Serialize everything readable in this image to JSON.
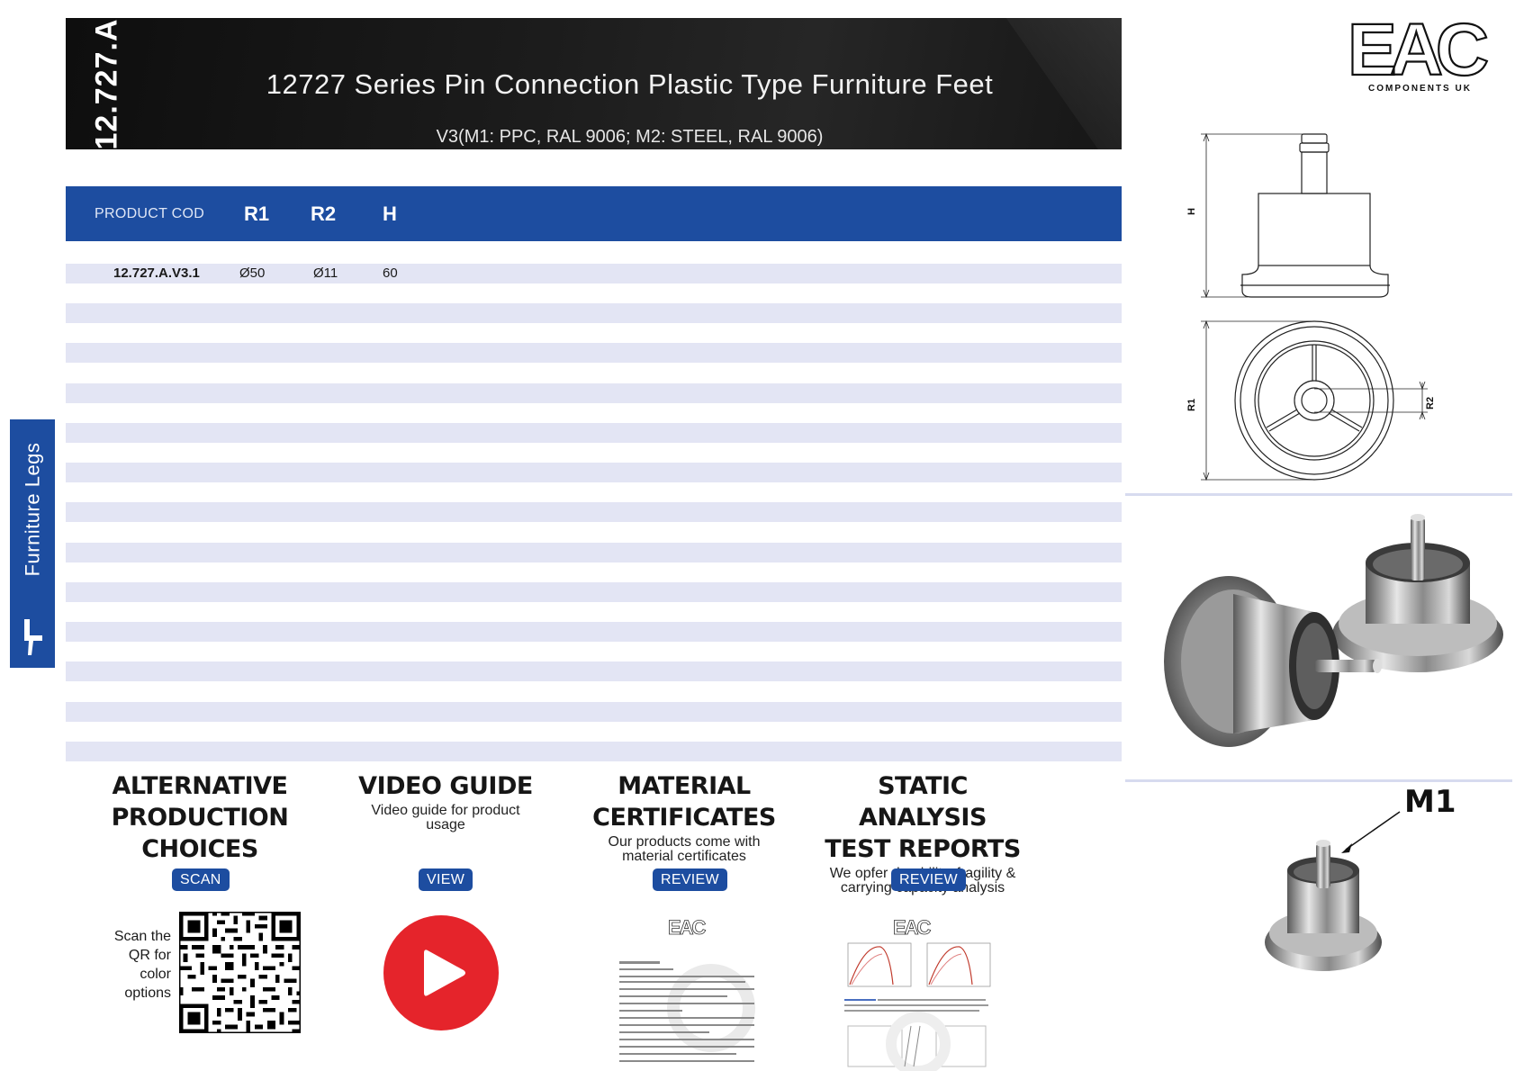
{
  "header": {
    "series_code": "12.727.A",
    "title": "12727 Series Pin Connection Plastic Type Furniture Feet",
    "subtitle": "V3(M1: PPC, RAL 9006; M2: STEEL, RAL 9006)"
  },
  "table": {
    "columns": [
      "PRODUCT COD",
      "R1",
      "R2",
      "H"
    ],
    "rows": [
      {
        "code": "12.727.A.V3.1",
        "r1": "Ø50",
        "r2": "Ø11",
        "h": "60"
      }
    ]
  },
  "sidebar": {
    "category": "Furniture Legs"
  },
  "logo": {
    "letters": "EAC",
    "tagline": "COMPONENTS UK"
  },
  "drawing": {
    "label_h": "H",
    "label_r1": "R1",
    "label_r2": "R2"
  },
  "callout": {
    "label": "M1"
  },
  "info_blocks": [
    {
      "title_lines": [
        "ALTERNATIVE",
        "PRODUCTION",
        "CHOICES"
      ],
      "description": "",
      "button": "SCAN"
    },
    {
      "title_lines": [
        "VIDEO GUIDE"
      ],
      "description": "Video guide for product usage",
      "button": "VIEW"
    },
    {
      "title_lines": [
        "MATERIAL",
        "CERTIFICATES"
      ],
      "description": "Our products come with material certificates",
      "button": "REVIEW"
    },
    {
      "title_lines": [
        "STATIC ANALYSIS",
        "TEST REPORTS"
      ],
      "description": "We opfer durability, fragility & carrying capacity analysis",
      "button": "REVIEW"
    }
  ],
  "scan_note": "Scan the QR for color options",
  "colors": {
    "brand_blue": "#1d4da0",
    "stripe": "#e3e5f4",
    "header_dark": "#161616",
    "play_red": "#e5242b"
  }
}
